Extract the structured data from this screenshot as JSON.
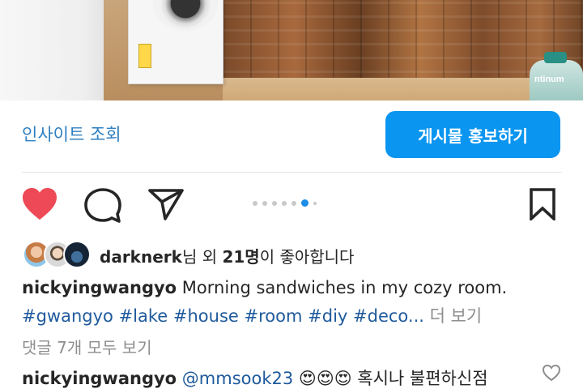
{
  "post_image": {
    "bottle_label": "ntinum"
  },
  "insights": {
    "view_insights_label": "인사이트 조회",
    "promote_button_label": "게시물 홍보하기"
  },
  "actions": {
    "like_icon": "heart-filled-icon",
    "comment_icon": "comment-bubble-icon",
    "share_icon": "paper-plane-icon",
    "save_icon": "bookmark-icon",
    "like_color": "#ed4956",
    "carousel": {
      "total": 8,
      "active_index": 6
    }
  },
  "likes": {
    "user": "darknerk",
    "text_mid": "님 외 ",
    "count": "21명",
    "text_end": "이 좋아합니다"
  },
  "caption": {
    "username": "nickyingwangyo",
    "text": " Morning sandwiches in my cozy room.",
    "hashtags": [
      "#gwangyo",
      "#lake",
      "#house",
      "#room",
      "#diy",
      "#deco"
    ],
    "ellipsis": "...",
    "more_label": " 더 보기"
  },
  "comments": {
    "view_all_label": "댓글 7개 모두 보기",
    "first": {
      "username": "nickyingwangyo",
      "mention": "@mmsook23",
      "emoji": "😍😍😍",
      "text": " 혹시나 불편하신점"
    }
  },
  "colors": {
    "accent": "#0a95f0",
    "link": "#2f7fc1",
    "hashtag": "#1f5a9c",
    "muted": "#8e8e8e"
  }
}
